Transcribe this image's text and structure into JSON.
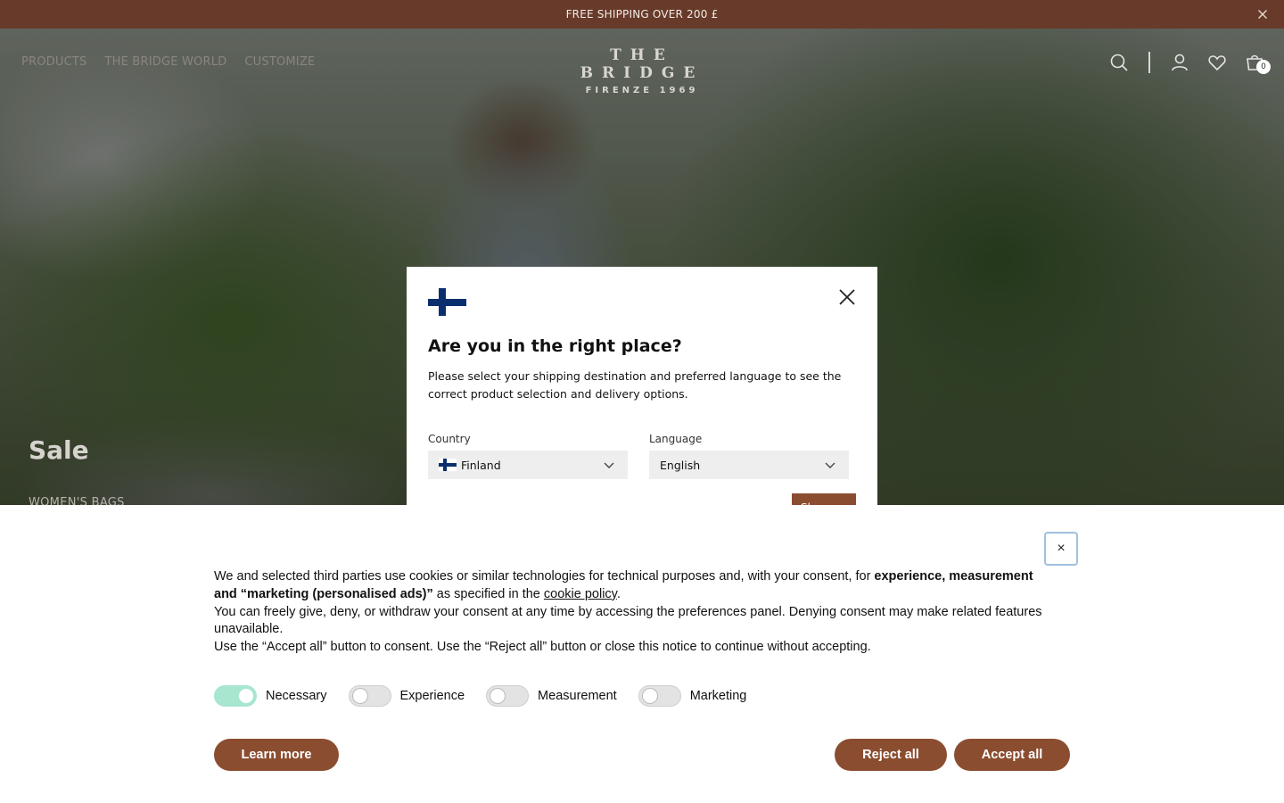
{
  "announcement": {
    "text": "FREE SHIPPING OVER 200 £"
  },
  "nav": {
    "items": [
      "PRODUCTS",
      "THE BRIDGE WORLD",
      "CUSTOMIZE"
    ]
  },
  "logo": {
    "main": "THE BRIDGE",
    "sub": "FIRENZE 1969"
  },
  "header_icons": [
    "search-icon",
    "user-icon",
    "heart-icon",
    "cart-icon"
  ],
  "cart": {
    "count": "0"
  },
  "hero": {
    "title": "Sale",
    "subtitle": "WOMEN'S BAGS"
  },
  "modal": {
    "title": "Are you in the right place?",
    "description": "Please select your shipping destination and preferred language to see the correct product selection and delivery options.",
    "country_label": "Country",
    "country_value": "Finland",
    "language_label": "Language",
    "language_value": "English",
    "button_label": "Sh..."
  },
  "cookie": {
    "close_label": "×",
    "p1_a": "We and selected third parties use cookies or similar technologies for technical purposes and, with your consent, for ",
    "p1_bold": "experience, measurement and “marketing (personalised ads)”",
    "p1_b": " as specified in the ",
    "p1_link": "cookie policy",
    "p1_c": ".",
    "p2": "You can freely give, deny, or withdraw your consent at any time by accessing the preferences panel. Denying consent may make related features unavailable.",
    "p3": "Use the “Accept all” button to consent. Use the “Reject all” button or close this notice to continue without accepting.",
    "toggles": [
      {
        "label": "Necessary",
        "on": true
      },
      {
        "label": "Experience",
        "on": false
      },
      {
        "label": "Measurement",
        "on": false
      },
      {
        "label": "Marketing",
        "on": false
      }
    ],
    "learn_more": "Learn more",
    "reject_all": "Reject all",
    "accept_all": "Accept all"
  },
  "colors": {
    "brand_brown": "#673a2a",
    "button_brown": "#8b4d30",
    "toggle_on": "#a8e6cf"
  }
}
